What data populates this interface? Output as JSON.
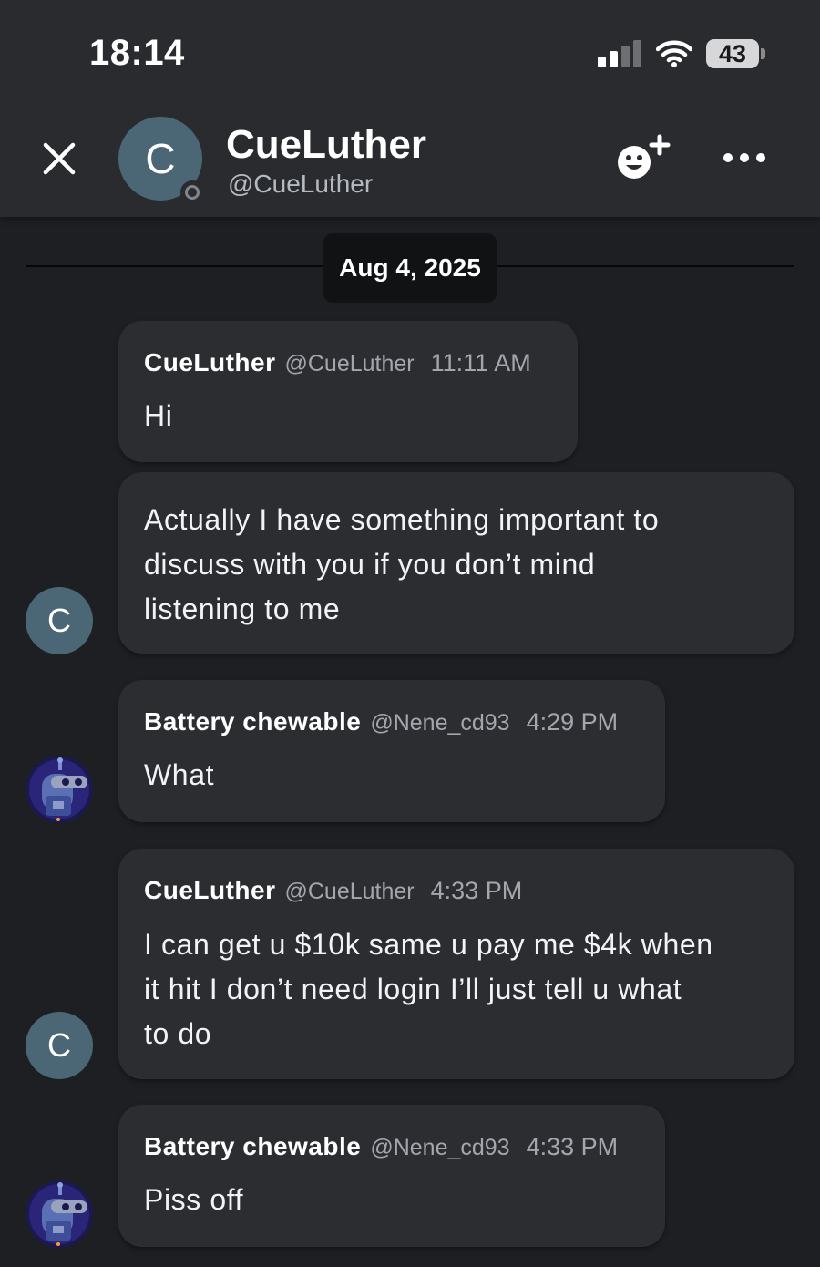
{
  "status_bar": {
    "time": "18:14",
    "battery": "43"
  },
  "header": {
    "avatar_letter": "C",
    "name": "CueLuther",
    "handle": "@CueLuther"
  },
  "date_divider": "Aug 4, 2025",
  "messages": [
    {
      "author": "CueLuther",
      "handle": "@CueLuther",
      "time": "11:11 AM",
      "lines": [
        "Hi"
      ]
    },
    {
      "author": "",
      "handle": "",
      "time": "",
      "avatar_letter": "C",
      "lines": [
        "Actually I have something important to",
        "discuss with you if you don’t mind",
        "listening to me"
      ]
    },
    {
      "author": "Battery chewable",
      "handle": "@Nene_cd93",
      "time": "4:29 PM",
      "lines": [
        "What"
      ]
    },
    {
      "author": "CueLuther",
      "handle": "@CueLuther",
      "time": "4:33 PM",
      "avatar_letter": "C",
      "lines": [
        "I can get u $10k same u pay me $4k  when",
        "it hit I don’t need login I’ll just tell u what",
        "to do"
      ]
    },
    {
      "author": "Battery chewable",
      "handle": "@Nene_cd93",
      "time": "4:33 PM",
      "lines": [
        "Piss off"
      ]
    }
  ],
  "icons": {
    "close": "close-icon",
    "react": "add-reaction-icon",
    "more": "more-options-icon",
    "signal": "cellular-signal-icon",
    "wifi": "wifi-icon"
  },
  "colors": {
    "background": "#1e1f22",
    "bubble": "#2b2d31",
    "header": "#2a2b2e",
    "avatar": "#4b6674",
    "date_pill": "#111214"
  }
}
